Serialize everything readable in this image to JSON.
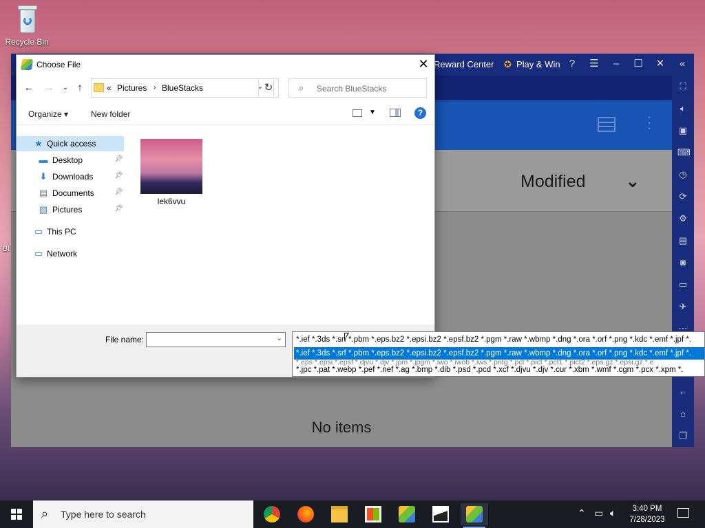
{
  "desktop": {
    "recycle_bin_label": "Recycle Bin",
    "partial_icon_label": "Bl"
  },
  "bluestacks": {
    "reward_center": "Reward Center",
    "play_and_win": "Play & Win",
    "header_sort_label": "Modified",
    "empty_state": "No items"
  },
  "dialog": {
    "title": "Choose File",
    "path": [
      "Pictures",
      "BlueStacks"
    ],
    "path_prefix": "«",
    "search_placeholder": "Search BlueStacks",
    "toolbar": {
      "organize": "Organize ▾",
      "new_folder": "New folder",
      "help": "?"
    },
    "nav": {
      "quick_access": "Quick access",
      "desktop": "Desktop",
      "downloads": "Downloads",
      "documents": "Documents",
      "pictures": "Pictures",
      "this_pc": "This PC",
      "network": "Network"
    },
    "files": [
      {
        "name": "lek6vvu"
      }
    ],
    "file_name_label": "File name:",
    "file_name_value": "",
    "file_types": [
      "*.ief *.3ds *.srf *.pbm *.eps.bz2 *.epsi.bz2 *.epsf.bz2 *.pgm *.raw *.wbmp *.dng *.ora *.orf *.png *.kdc *.emf *.jpf *.",
      "*.ief *.3ds *.srf *.pbm *.eps.bz2 *.epsi.bz2 *.epsf.bz2 *.pgm *.raw *.wbmp *.dng *.ora *.orf *.png *.kdc *.emf *.jpf *.",
      "*.eps *.epsi *.epsf *.djvu *.djv *.jpm *.jpgm *.iwo *.iwob *.iws *.pntg *.pct *.pict *.pct1 *.pict2 *.eps.gz *.epsi.gz *.e",
      "*.jpc *.pat *.webp *.pef *.nef *.ag *.bmp *.dib *.psd *.pcd *.xcf *.djvu *.djv *.cur *.xbm *.wmf *.cgm *.pcx *.xpm *."
    ]
  },
  "taskbar": {
    "search_placeholder": "Type here to search",
    "time": "3:40 PM",
    "date": "7/28/2023"
  }
}
